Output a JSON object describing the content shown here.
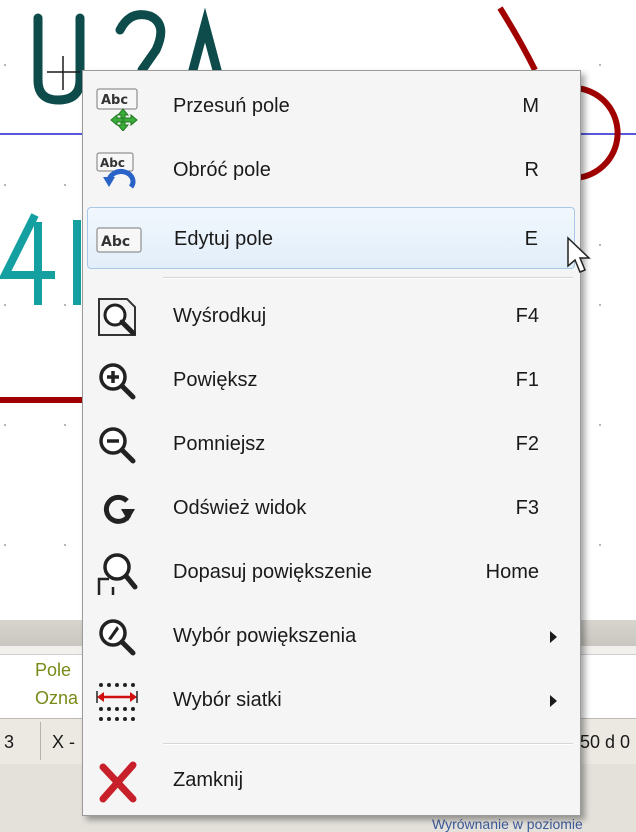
{
  "status_bar": {
    "field_label_1": "Pole",
    "field_label_2": "Ozna",
    "coord_prefix": "3",
    "coord_x": "X -",
    "coord_right": "50  d 0",
    "bottom_text": "Wyrównanie w poziomie"
  },
  "context_menu": {
    "items": [
      {
        "label": "Przesuń pole",
        "shortcut": "M",
        "icon": "move-field-icon"
      },
      {
        "label": "Obróć pole",
        "shortcut": "R",
        "icon": "rotate-field-icon"
      },
      {
        "label": "Edytuj pole",
        "shortcut": "E",
        "icon": "edit-field-icon",
        "highlighted": true
      },
      {
        "label": "Wyśrodkuj",
        "shortcut": "F4",
        "icon": "center-icon"
      },
      {
        "label": "Powiększ",
        "shortcut": "F1",
        "icon": "zoom-in-icon"
      },
      {
        "label": "Pomniejsz",
        "shortcut": "F2",
        "icon": "zoom-out-icon"
      },
      {
        "label": "Odśwież widok",
        "shortcut": "F3",
        "icon": "refresh-icon"
      },
      {
        "label": "Dopasuj powiększenie",
        "shortcut": "Home",
        "icon": "zoom-fit-icon"
      },
      {
        "label": "Wybór powiększenia",
        "shortcut": "",
        "icon": "zoom-select-icon",
        "submenu": true
      },
      {
        "label": "Wybór siatki",
        "shortcut": "",
        "icon": "grid-select-icon",
        "submenu": true
      },
      {
        "label": "Zamknij",
        "shortcut": "",
        "icon": "close-icon"
      }
    ]
  },
  "icon_text": {
    "abc": "Abc"
  },
  "colors": {
    "canvas_bg": "#ffffff",
    "schematic_teal": "#0e4b4b",
    "wire_red": "#a00000",
    "pin_cyan": "#14a0a0",
    "grid_line_blue": "#2020d0",
    "menu_bg": "#f5f5f5",
    "highlight_border": "#a8c8ea"
  }
}
